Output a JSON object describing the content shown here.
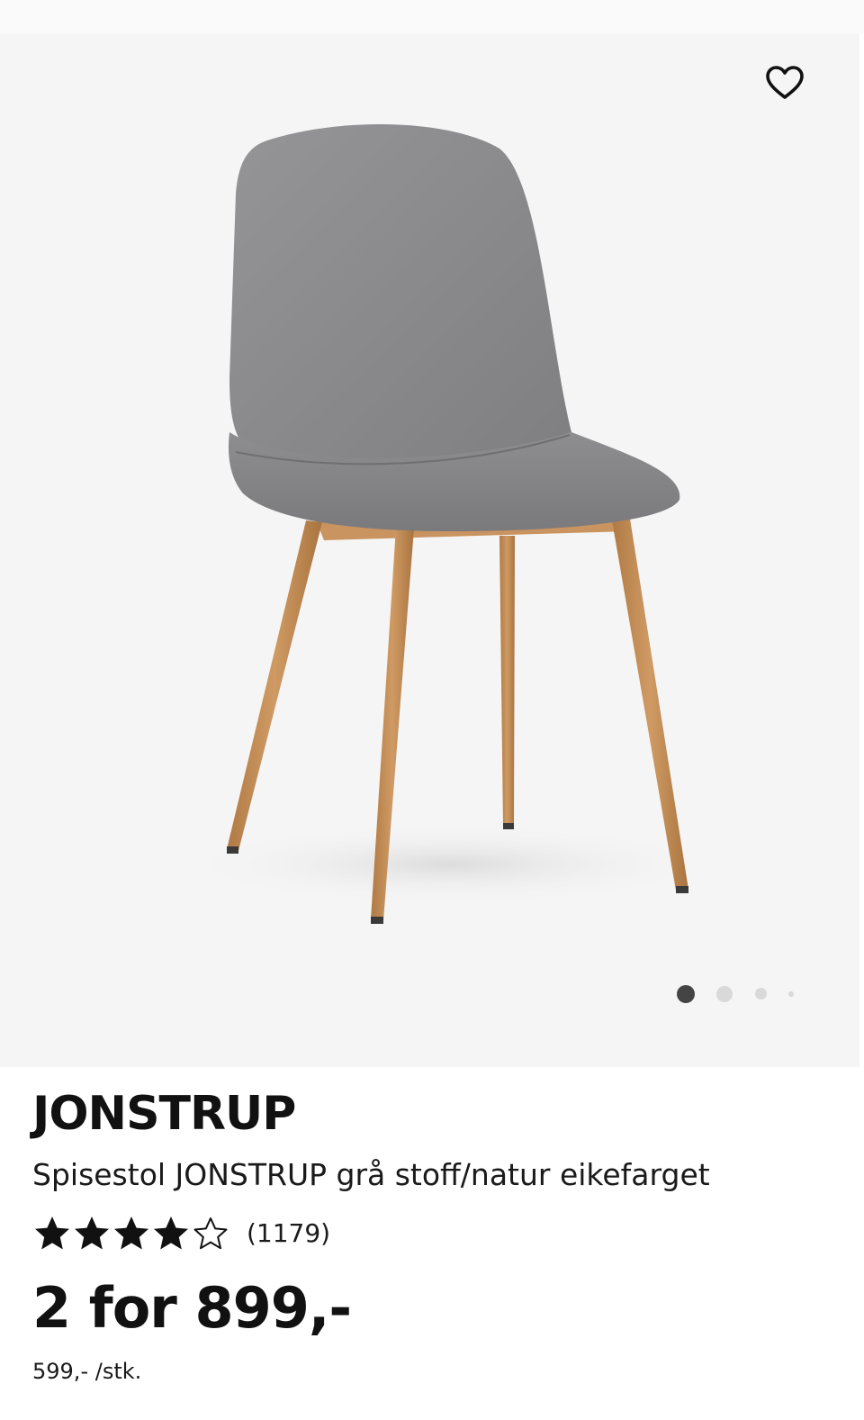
{
  "gallery": {
    "image_alt": "Grey upholstered dining chair with oak-colored legs",
    "favorite_icon": "heart-outline-icon",
    "slides_total": 4,
    "active_slide": 1,
    "colors": {
      "background": "#f5f5f5",
      "seat": "#8a8a8c",
      "legs": "#c38d57",
      "dot_active": "#444444",
      "dot_inactive": "#d9d9d9"
    }
  },
  "product": {
    "brand": "JONSTRUP",
    "subtitle": "Spisestol JONSTRUP grå stoff/natur eikefarget",
    "rating": {
      "value": 4,
      "max": 5,
      "count_label": "(1179)",
      "filled_icon": "star-filled-icon",
      "empty_icon": "star-outline-icon"
    },
    "price": "2 for 899,-",
    "unit_price": "599,- /stk."
  }
}
